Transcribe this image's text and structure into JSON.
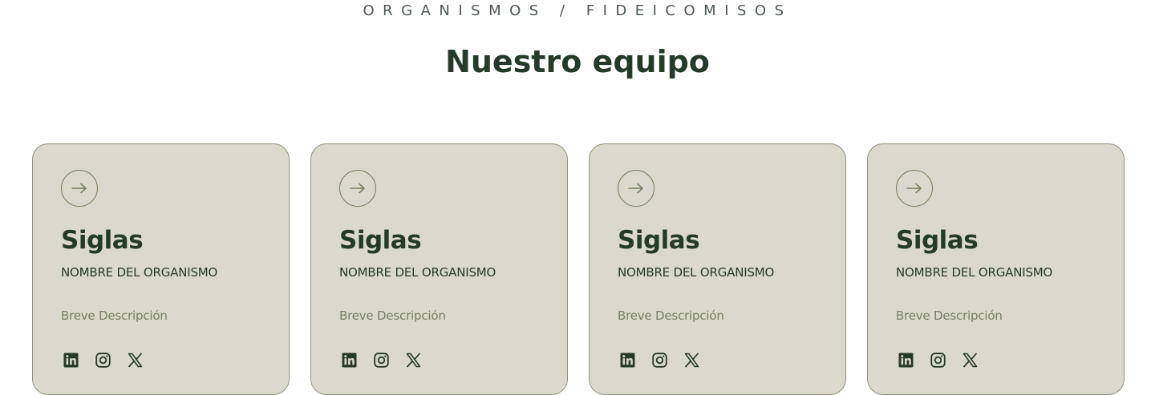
{
  "section": {
    "eyebrow": "ORGANISMOS / FIDEICOMISOS",
    "title": "Nuestro equipo"
  },
  "colors": {
    "card_bg": "#dbd9cd",
    "card_border": "#8f9278",
    "dark_green": "#263a2a",
    "muted_green": "#75805f",
    "eyebrow_gray": "#4e5752"
  },
  "cards": [
    {
      "siglas": "Siglas",
      "nombre": "NOMBRE DEL ORGANISMO",
      "descripcion": "Breve Descripción",
      "arrow_icon": "arrow-right-icon",
      "socials": [
        "linkedin-icon",
        "instagram-icon",
        "x-icon"
      ]
    },
    {
      "siglas": "Siglas",
      "nombre": "NOMBRE DEL ORGANISMO",
      "descripcion": "Breve Descripción",
      "arrow_icon": "arrow-right-icon",
      "socials": [
        "linkedin-icon",
        "instagram-icon",
        "x-icon"
      ]
    },
    {
      "siglas": "Siglas",
      "nombre": "NOMBRE DEL ORGANISMO",
      "descripcion": "Breve Descripción",
      "arrow_icon": "arrow-right-icon",
      "socials": [
        "linkedin-icon",
        "instagram-icon",
        "x-icon"
      ]
    },
    {
      "siglas": "Siglas",
      "nombre": "NOMBRE DEL ORGANISMO",
      "descripcion": "Breve Descripción",
      "arrow_icon": "arrow-right-icon",
      "socials": [
        "linkedin-icon",
        "instagram-icon",
        "x-icon"
      ]
    }
  ]
}
